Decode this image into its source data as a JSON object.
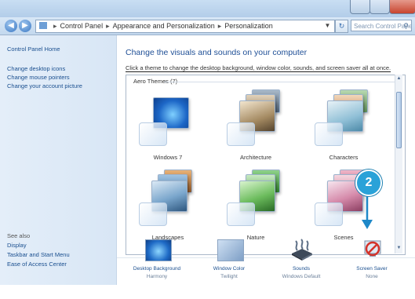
{
  "window": {
    "title": ""
  },
  "address_bar": {
    "segments": [
      "Control Panel",
      "Appearance and Personalization",
      "Personalization"
    ],
    "search_placeholder": "Search Control Panel"
  },
  "sidebar": {
    "home_link": "Control Panel Home",
    "links": [
      "Change desktop icons",
      "Change mouse pointers",
      "Change your account picture"
    ],
    "see_also_heading": "See also",
    "see_also_links": [
      "Display",
      "Taskbar and Start Menu",
      "Ease of Access Center"
    ]
  },
  "main": {
    "title": "Change the visuals and sounds on your computer",
    "description": "Click a theme to change the desktop background, window color, sounds, and screen saver all at once.",
    "theme_group_heading": "Aero Themes (7)",
    "themes": [
      {
        "name": "Windows 7",
        "icon": "windows7-theme-icon"
      },
      {
        "name": "Architecture",
        "icon": "architecture-theme-icon"
      },
      {
        "name": "Characters",
        "icon": "characters-theme-icon"
      },
      {
        "name": "Landscapes",
        "icon": "landscapes-theme-icon"
      },
      {
        "name": "Nature",
        "icon": "nature-theme-icon"
      },
      {
        "name": "Scenes",
        "icon": "scenes-theme-icon"
      }
    ]
  },
  "bottom_settings": [
    {
      "label": "Desktop Background",
      "value": "Harmony",
      "icon": "desktop-background-icon"
    },
    {
      "label": "Window Color",
      "value": "Twilight",
      "icon": "window-color-icon"
    },
    {
      "label": "Sounds",
      "value": "Windows Default",
      "icon": "sounds-icon"
    },
    {
      "label": "Screen Saver",
      "value": "None",
      "icon": "screen-saver-icon"
    }
  ],
  "callout": {
    "number": "2"
  },
  "colors": {
    "accent": "#2aa2d8",
    "link": "#1a4f8f",
    "title": "#1f4f96",
    "arrow": "#1e88c8"
  }
}
